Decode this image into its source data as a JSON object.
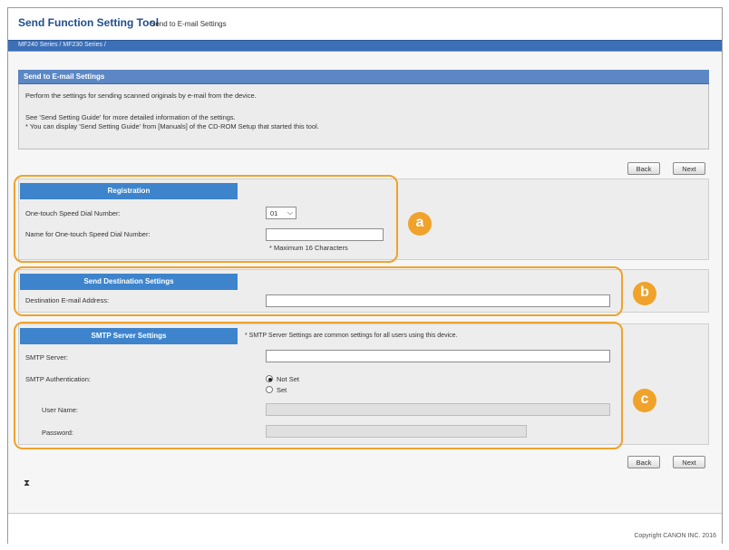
{
  "header": {
    "app_title": "Send Function Setting Tool",
    "page_subtitle": "Send to E-mail Settings"
  },
  "breadcrumb": "MF240 Series / MF230 Series /",
  "info": {
    "title": "Send to E-mail Settings",
    "line1": "Perform the settings for sending scanned originals by e-mail from the device.",
    "line2": "See 'Send Setting Guide' for more detailed information of the settings.",
    "line3": "* You can display 'Send Setting Guide' from [Manuals] of the CD-ROM Setup that started this tool."
  },
  "nav": {
    "back": "Back",
    "next": "Next"
  },
  "registration": {
    "title": "Registration",
    "speed_dial_label": "One-touch Speed Dial Number:",
    "speed_dial_value": "01",
    "name_label": "Name for One-touch Speed Dial Number:",
    "name_value": "",
    "name_hint": "* Maximum 16 Characters"
  },
  "destination": {
    "title": "Send Destination Settings",
    "email_label": "Destination E-mail Address:",
    "email_value": ""
  },
  "smtp": {
    "title": "SMTP Server Settings",
    "note": "* SMTP Server Settings are common settings for all users using this device.",
    "server_label": "SMTP Server:",
    "server_value": "",
    "auth_label": "SMTP Authentication:",
    "auth_options": [
      "Not Set",
      "Set"
    ],
    "auth_selected": "Not Set",
    "username_label": "User Name:",
    "password_label": "Password:"
  },
  "callouts": [
    "a",
    "b",
    "c"
  ],
  "top_icon": "⧗",
  "copyright": "Copyright CANON INC. 2016",
  "colors": {
    "brand_blue": "#1f4e8c",
    "section_header": "#3d84cc",
    "callout_orange": "#f0a22a"
  }
}
